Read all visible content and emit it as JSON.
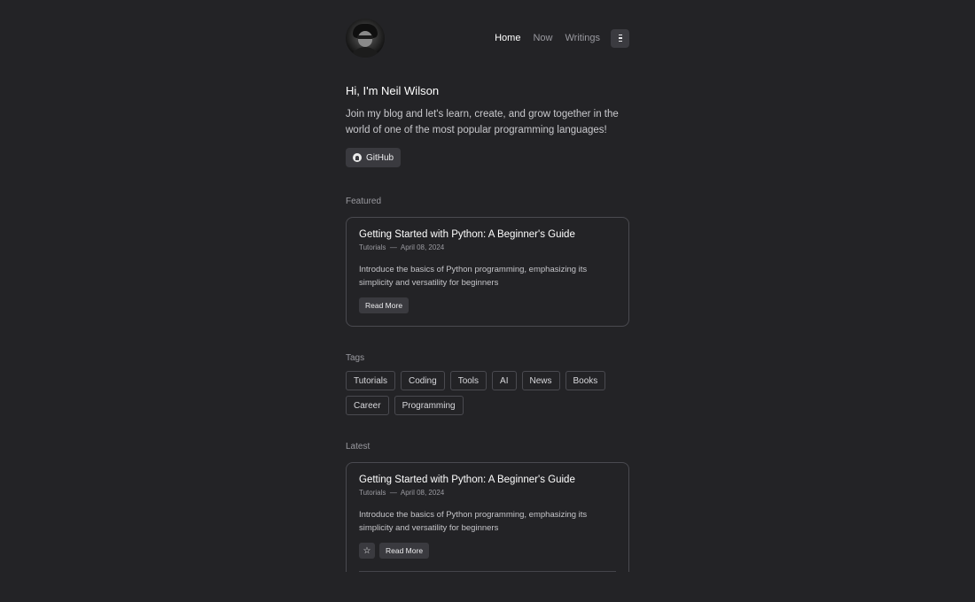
{
  "header": {
    "nav": [
      {
        "label": "Home",
        "active": true
      },
      {
        "label": "Now",
        "active": false
      },
      {
        "label": "Writings",
        "active": false
      }
    ],
    "menu_icon": "menu-icon"
  },
  "intro": {
    "title": "Hi, I'm Neil Wilson",
    "text": "Join my blog and let's learn, create, and grow together in the world of one of the most popular programming languages!",
    "github_label": "GitHub"
  },
  "featured": {
    "label": "Featured",
    "post": {
      "title": "Getting Started with Python: A Beginner's Guide",
      "category": "Tutorials",
      "separator": "—",
      "date": "April 08, 2024",
      "description": "Introduce the basics of Python programming, emphasizing its simplicity and versatility for beginners",
      "read_more": "Read More"
    }
  },
  "tags": {
    "label": "Tags",
    "items": [
      "Tutorials",
      "Coding",
      "Tools",
      "AI",
      "News",
      "Books",
      "Career",
      "Programming"
    ]
  },
  "latest": {
    "label": "Latest",
    "post": {
      "title": "Getting Started with Python: A Beginner's Guide",
      "category": "Tutorials",
      "separator": "—",
      "date": "April 08, 2024",
      "description": "Introduce the basics of Python programming, emphasizing its simplicity and versatility for beginners",
      "read_more": "Read More",
      "star_icon": "star-icon"
    }
  },
  "colors": {
    "background": "#232326",
    "card_border": "#4a4a50",
    "button_bg": "#3a3a3f"
  }
}
